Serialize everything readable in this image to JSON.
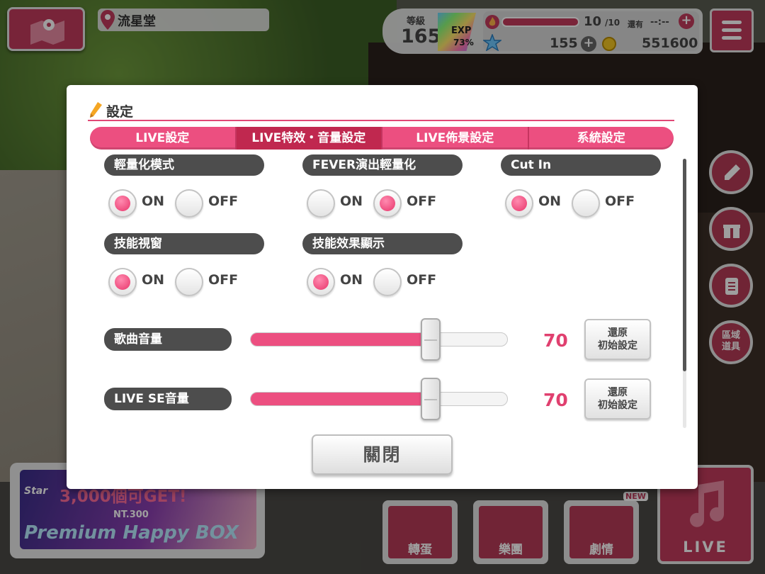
{
  "hud": {
    "location": "流星堂",
    "rank_label": "等級",
    "rank_value": "165",
    "exp_label": "EXP",
    "exp_percent": "73%",
    "stamina_value": "10",
    "stamina_max": "/10",
    "remaining_label": "還有",
    "timer": "--:--",
    "stars": "155",
    "coins": "551600"
  },
  "side_buttons": {
    "area_items": "區域\n道具"
  },
  "banner": {
    "star_text": "Star",
    "big_text": "3,000個可GET!",
    "price_text": "NT.300",
    "box_text": "Premium Happy BOX"
  },
  "nav": {
    "gacha": "轉蛋",
    "band": "樂團",
    "story": "劇情",
    "new_badge": "NEW",
    "live": "LIVE"
  },
  "dialog": {
    "title": "設定",
    "tabs": [
      "LIVE設定",
      "LIVE特效・音量設定",
      "LIVE佈景設定",
      "系統設定"
    ],
    "active_tab": 1,
    "on_label": "ON",
    "off_label": "OFF",
    "options": [
      {
        "label": "輕量化模式",
        "selected": "ON"
      },
      {
        "label": "FEVER演出輕量化",
        "selected": "OFF"
      },
      {
        "label": "Cut In",
        "selected": "ON"
      },
      {
        "label": "技能視窗",
        "selected": "ON"
      },
      {
        "label": "技能效果顯示",
        "selected": "ON"
      }
    ],
    "volumes": [
      {
        "label": "歌曲音量",
        "value": 70,
        "value_text": "70"
      },
      {
        "label": "LIVE SE音量",
        "value": 70,
        "value_text": "70"
      }
    ],
    "reset_label_1": "還原",
    "reset_label_2": "初始設定",
    "close_label": "關閉"
  },
  "colors": {
    "accent": "#ec4f80",
    "accent_dark": "#c0284f",
    "label_bg": "#4d4d4d"
  }
}
